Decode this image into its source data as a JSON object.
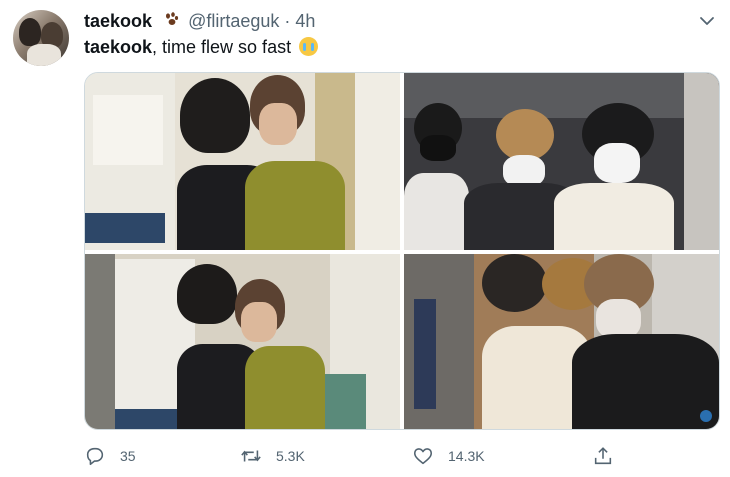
{
  "tweet": {
    "display_name": "taekook",
    "handle": "@flirtaeguk",
    "separator": "·",
    "time": "4h",
    "text_bold": "taekook",
    "text_rest": ", time flew so fast",
    "emoji": "loudly-crying-face"
  },
  "actions": {
    "replies": "35",
    "retweets": "5.3K",
    "likes": "14.3K"
  },
  "colors": {
    "text": "#0f1419",
    "secondary": "#536471",
    "border": "#cfd9de"
  },
  "icons": [
    "paw-prints-icon",
    "chevron-down-icon",
    "reply-icon",
    "retweet-icon",
    "like-icon",
    "share-icon"
  ]
}
